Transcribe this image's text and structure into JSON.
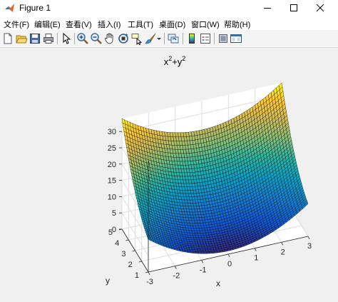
{
  "window": {
    "title": "Figure 1",
    "controls": [
      "minimize-icon",
      "maximize-icon",
      "close-icon"
    ]
  },
  "menubar": {
    "items": [
      {
        "label": "文件(F)"
      },
      {
        "label": "编辑(E)"
      },
      {
        "label": "查看(V)"
      },
      {
        "label": "插入(I)"
      },
      {
        "label": "工具(T)"
      },
      {
        "label": "桌面(D)"
      },
      {
        "label": "窗口(W)"
      },
      {
        "label": "帮助(H)"
      }
    ]
  },
  "toolbar": {
    "icons": [
      "new-figure-icon",
      "open-file-icon",
      "save-icon",
      "print-icon",
      "edit-plot-arrow-icon",
      "zoom-in-icon",
      "zoom-out-icon",
      "pan-hand-icon",
      "rotate-3d-icon",
      "data-cursor-icon",
      "brush-icon",
      "brush-dropdown-icon",
      "link-plot-icon",
      "insert-colorbar-icon",
      "insert-legend-icon",
      "hide-plot-tools-icon",
      "show-plot-tools-icon"
    ]
  },
  "colors": {
    "colormap": [
      "#352a87",
      "#0f5cdd",
      "#1481d6",
      "#06a4ca",
      "#2eb7a4",
      "#87bf77",
      "#d1bb59",
      "#fec832",
      "#f9fb0e"
    ],
    "mesh_edge": "#000000",
    "axes_background": "#ffffff",
    "figure_background": "#f0f0f0"
  },
  "chart_data": {
    "type": "surface",
    "title": "x²+y²",
    "title_base": "x",
    "title_mid": "+y",
    "title_exp": "2",
    "function": "z = x^2 + y^2",
    "xlabel": "x",
    "ylabel": "y",
    "zlabel": "",
    "xlim": [
      -3,
      3
    ],
    "ylim": [
      1,
      5
    ],
    "zlim": [
      0,
      34
    ],
    "x_ticks": [
      -3,
      -2,
      -1,
      0,
      1,
      2,
      3
    ],
    "y_ticks": [
      1,
      2,
      3,
      4,
      5
    ],
    "z_ticks": [
      0,
      5,
      10,
      15,
      20,
      25,
      30
    ],
    "x_tick_labels": [
      "-3",
      "-2",
      "-1",
      "0",
      "1",
      "2",
      "3"
    ],
    "y_tick_labels": [
      "1",
      "2",
      "3",
      "4",
      "5"
    ],
    "z_tick_labels": [
      "0",
      "5",
      "10",
      "15",
      "20",
      "25",
      "30"
    ],
    "grid": true,
    "box": true,
    "shading": "faceted",
    "colormap": "parula",
    "mesh_size": [
      61,
      41
    ]
  }
}
